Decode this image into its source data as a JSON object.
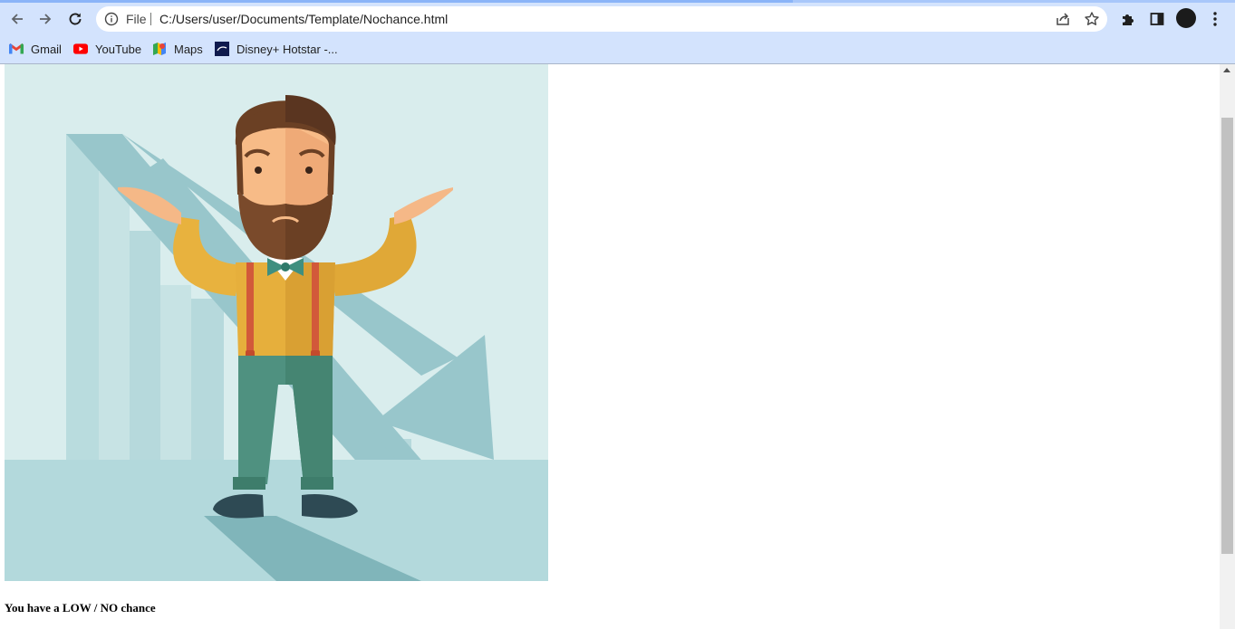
{
  "browser": {
    "omnibox": {
      "scheme_label": "File",
      "url": "C:/Users/user/Documents/Template/Nochance.html"
    },
    "bookmarks": [
      {
        "label": "Gmail",
        "icon": "gmail-icon"
      },
      {
        "label": "YouTube",
        "icon": "youtube-icon"
      },
      {
        "label": "Maps",
        "icon": "maps-icon"
      },
      {
        "label": "Disney+ Hotstar -...",
        "icon": "hotstar-icon"
      }
    ]
  },
  "page": {
    "caption": "You have a LOW / NO chance"
  },
  "colors": {
    "toolbar_bg": "#d3e3fd",
    "illustration_bg": "#d9eded",
    "shirt": "#e6af3c",
    "pants": "#4f9180",
    "suspenders": "#d2593a"
  }
}
